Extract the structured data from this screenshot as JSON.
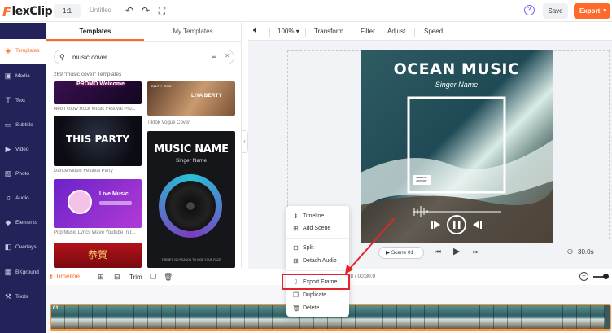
{
  "app": {
    "logo_text": "lexClip",
    "logo_mark": "F",
    "ratio": "1:1",
    "doc_title": "Untitled",
    "save_label": "Save",
    "export_label": "Export",
    "help_glyph": "?"
  },
  "sidebar": {
    "items": [
      {
        "label": "Templates",
        "icon": "templates-icon",
        "glyph": "◈"
      },
      {
        "label": "Media",
        "icon": "media-icon",
        "glyph": "▣"
      },
      {
        "label": "Text",
        "icon": "text-icon",
        "glyph": "T"
      },
      {
        "label": "Subtitle",
        "icon": "subtitle-icon",
        "glyph": "▭"
      },
      {
        "label": "Video",
        "icon": "video-icon",
        "glyph": "▶"
      },
      {
        "label": "Photo",
        "icon": "photo-icon",
        "glyph": "▨"
      },
      {
        "label": "Audio",
        "icon": "audio-icon",
        "glyph": "♫"
      },
      {
        "label": "Elements",
        "icon": "elements-icon",
        "glyph": "◆"
      },
      {
        "label": "Overlays",
        "icon": "overlays-icon",
        "glyph": "◧"
      },
      {
        "label": "BKground",
        "icon": "background-icon",
        "glyph": "▦"
      },
      {
        "label": "Tools",
        "icon": "tools-icon",
        "glyph": "⚒"
      }
    ]
  },
  "panel": {
    "tabs": [
      "Templates",
      "My Templates"
    ],
    "search_value": "music cover",
    "result_count": "269 \"music cover\" Templates",
    "templates": [
      {
        "caption": "Neon Glow Rock Music Festival Pro...",
        "title": "PROMO Welcome"
      },
      {
        "caption": "Tiktok Vogue Cover",
        "title": "LIYA BERTY",
        "date": "JULY 7 2022"
      },
      {
        "caption": "Dance Music Festival Party",
        "title": "THIS PARTY"
      },
      {
        "caption": "Pop Music Lyrics Wave Youtube Intr...",
        "title": "Live Music"
      },
      {
        "caption": "",
        "title": "MUSIC NAME",
        "subtitle": "Singer Name",
        "footer": "THERE'S NO REASON TO HIDE YOUR FACE"
      },
      {
        "caption": "",
        "title": "恭賀"
      }
    ]
  },
  "editor_toolbar": {
    "zoom": "100%",
    "items": [
      "Transform",
      "Filter",
      "Adjust",
      "Speed"
    ]
  },
  "poster": {
    "title": "OCEAN MUSIC",
    "subtitle": "Singer Name",
    "badge": "PARENTAL ADVISORY"
  },
  "player": {
    "scene_label": "Scene 01",
    "duration": "30.0s"
  },
  "timeline": {
    "label": "Timeline",
    "trim_label": "Trim",
    "time": "0.8 / 00:30.0",
    "clip_number": "01"
  },
  "context_menu": {
    "items": [
      {
        "label": "Timeline",
        "icon": "timeline-icon",
        "glyph": "⇟"
      },
      {
        "label": "Add Scene",
        "icon": "add-scene-icon",
        "glyph": "⊞"
      },
      {
        "label": "Split",
        "icon": "split-icon",
        "glyph": "⊟"
      },
      {
        "label": "Detach Audio",
        "icon": "detach-audio-icon",
        "glyph": "⊠"
      },
      {
        "label": "Export Frame",
        "icon": "export-frame-icon",
        "glyph": "⇩"
      },
      {
        "label": "Duplicate",
        "icon": "duplicate-icon",
        "glyph": "❐"
      },
      {
        "label": "Delete",
        "icon": "delete-icon",
        "glyph": "🗑"
      }
    ]
  },
  "colors": {
    "accent": "#ff6a2b",
    "sidebar": "#23235a",
    "annotation": "#e3242b"
  }
}
